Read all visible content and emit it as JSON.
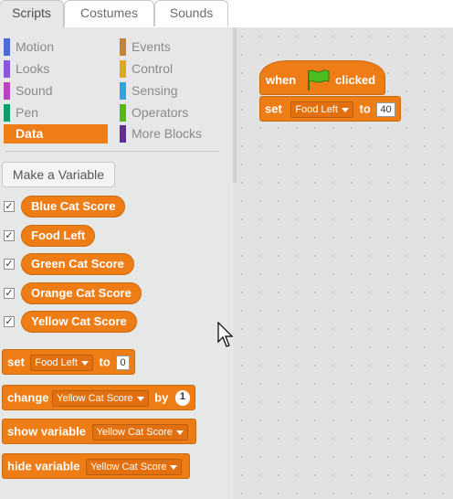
{
  "tabs": [
    "Scripts",
    "Costumes",
    "Sounds"
  ],
  "categories": {
    "left": [
      {
        "label": "Motion",
        "color": "#4a6cd4"
      },
      {
        "label": "Looks",
        "color": "#8a55d7"
      },
      {
        "label": "Sound",
        "color": "#bb42c3"
      },
      {
        "label": "Pen",
        "color": "#0e9a6c"
      },
      {
        "label": "Data",
        "color": "#ee7d16"
      }
    ],
    "right": [
      {
        "label": "Events",
        "color": "#c88330"
      },
      {
        "label": "Control",
        "color": "#e1a91a"
      },
      {
        "label": "Sensing",
        "color": "#2ca5e2"
      },
      {
        "label": "Operators",
        "color": "#5cb712"
      },
      {
        "label": "More Blocks",
        "color": "#632d99"
      }
    ]
  },
  "make_variable": "Make a Variable",
  "variables": [
    "Blue Cat Score",
    "Food Left",
    "Green Cat Score",
    "Orange Cat Score",
    "Yellow Cat Score"
  ],
  "blocks": {
    "set": {
      "kw": "set",
      "var": "Food Left",
      "to": "to",
      "value": "0"
    },
    "change": {
      "kw": "change",
      "var": "Yellow Cat Score",
      "by": "by",
      "value": "1"
    },
    "show": {
      "kw": "show variable",
      "var": "Yellow Cat Score"
    },
    "hide": {
      "kw": "hide variable",
      "var": "Yellow Cat Score"
    }
  },
  "script": {
    "when": "when",
    "clicked": "clicked",
    "set_kw": "set",
    "set_var": "Food Left",
    "set_to": "to",
    "set_value": "40"
  }
}
